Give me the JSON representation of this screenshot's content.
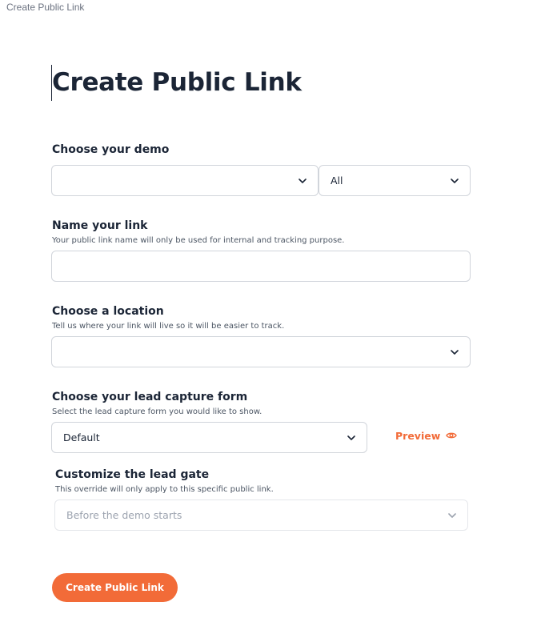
{
  "window": {
    "tab_title": "Create Public Link"
  },
  "page": {
    "title": "Create Public Link"
  },
  "demo": {
    "title": "Choose your demo",
    "demo_value": "",
    "filter_value": "All"
  },
  "link_name": {
    "title": "Name your link",
    "subtitle": "Your public link name will only be used for internal and tracking purpose.",
    "value": ""
  },
  "location": {
    "title": "Choose a location",
    "subtitle": "Tell us where your link will live so it will be easier to track.",
    "value": ""
  },
  "lead_form": {
    "title": "Choose your lead capture form",
    "subtitle": "Select the lead capture form you would like to show.",
    "value": "Default",
    "preview_label": "Preview"
  },
  "lead_gate": {
    "title": "Customize the lead gate",
    "subtitle": "This override will only apply to this specific public link.",
    "value": "Before the demo starts"
  },
  "submit": {
    "label": "Create Public Link"
  },
  "colors": {
    "accent": "#f26b38",
    "text": "#1b2536",
    "border": "#d1d5db"
  },
  "icons": {
    "dropdown": "chevron-down-icon",
    "preview": "eye-icon"
  }
}
